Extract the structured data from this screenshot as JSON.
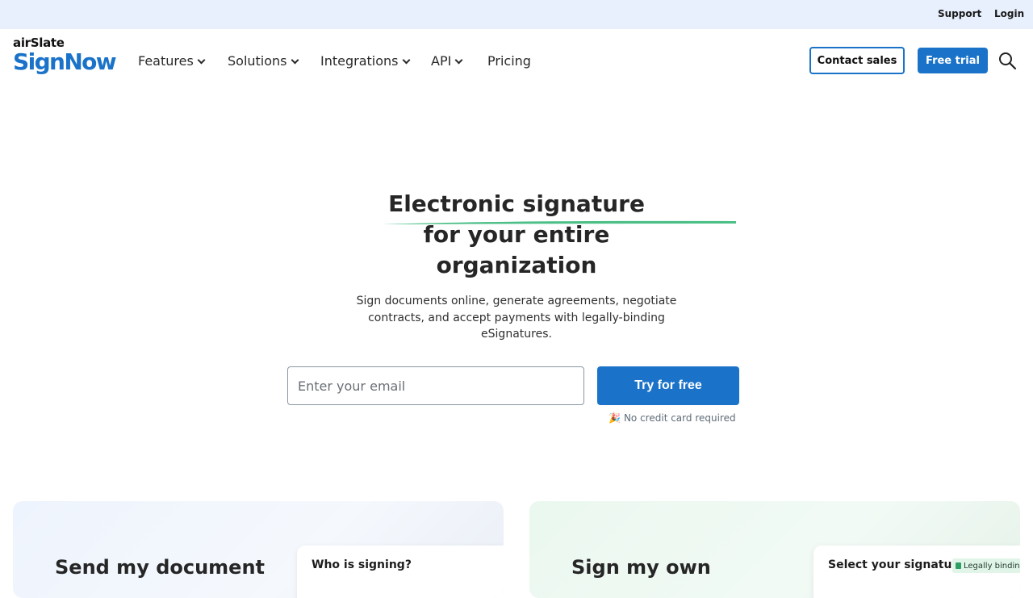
{
  "topbar": {
    "support": "Support",
    "login": "Login"
  },
  "logo": {
    "small": "airSlate",
    "big": "SignNow"
  },
  "nav": {
    "items": [
      {
        "label": "Features",
        "has_dropdown": true
      },
      {
        "label": "Solutions",
        "has_dropdown": true
      },
      {
        "label": "Integrations",
        "has_dropdown": true
      },
      {
        "label": "API",
        "has_dropdown": true
      },
      {
        "label": "Pricing",
        "has_dropdown": false
      }
    ],
    "contact_sales": "Contact sales",
    "free_trial": "Free trial",
    "search_icon": "search-icon"
  },
  "hero": {
    "title_line1": "Electronic signature",
    "title_line2": "for your entire",
    "title_line3": "organization",
    "subtitle": "Sign documents online, generate agreements, negotiate contracts, and accept payments with legally-binding eSignatures.",
    "email_placeholder": "Enter your email",
    "cta": "Try for free",
    "no_credit": "No credit card required",
    "party_icon": "🎉"
  },
  "cards": {
    "left": {
      "title": "Send my document",
      "panel_title": "Who is signing?"
    },
    "right": {
      "title": "Sign my own",
      "panel_title": "Select your signature",
      "badge": "Legally binding"
    }
  },
  "colors": {
    "brand_blue": "#1a73c9",
    "accent_green": "#4cbf87",
    "topbar_bg": "#e8f0fd"
  }
}
